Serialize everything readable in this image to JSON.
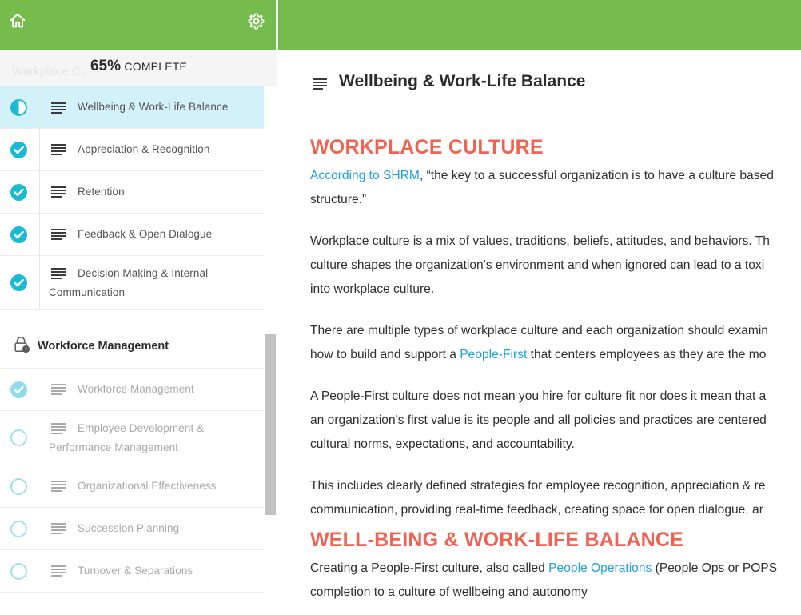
{
  "sidebar": {
    "progress_percent": "65%",
    "progress_label": "COMPLETE",
    "ghost_section_title": "Workplace Cu",
    "lessons_a": [
      {
        "label": "Wellbeing & Work-Life Balance",
        "status": "in-progress",
        "active": true
      },
      {
        "label": "Appreciation & Recognition",
        "status": "complete"
      },
      {
        "label": "Retention",
        "status": "complete"
      },
      {
        "label": "Feedback & Open Dialogue",
        "status": "complete"
      },
      {
        "label": "Decision Making & Internal Communication",
        "status": "complete"
      }
    ],
    "section": {
      "title": "Workforce Management",
      "icon": "lock-clock-icon"
    },
    "lessons_b": [
      {
        "label": "Workforce Management",
        "status": "complete-locked"
      },
      {
        "label": "Employee Development & Performance Management",
        "status": "not-started"
      },
      {
        "label": "Organizational Effectiveness",
        "status": "not-started"
      },
      {
        "label": "Succession Planning",
        "status": "not-started"
      },
      {
        "label": "Turnover & Separations",
        "status": "not-started"
      }
    ]
  },
  "main": {
    "page_title": "Wellbeing & Work-Life Balance",
    "heading_1": "WORKPLACE CULTURE",
    "p1_link": "According to SHRM",
    "p1_line1_rest": ", “the key to a successful organization is to have a culture based",
    "p1_line2": "structure.”",
    "p2_line1": "Workplace culture is a mix of values, traditions, beliefs, attitudes, and behaviors. Th",
    "p2_line2": "culture shapes the organization's environment and when ignored can lead to a toxi",
    "p2_line3": "into workplace culture.",
    "p3_line1": "There are multiple types of workplace culture and each organization should examin",
    "p3_line2_start": "how to build and support a ",
    "p3_link": "People-First",
    "p3_line2_end": " that centers employees as they are the mo",
    "p4_line1": "A People-First culture does not mean you hire for culture fit nor does it mean that a",
    "p4_line2": "an organization's first value is its people and all policies and practices are centered",
    "p4_line3": "cultural norms, expectations, and accountability.",
    "p5_line1": "This includes clearly defined strategies for employee recognition, appreciation & re",
    "p5_line2": "communication, providing real-time feedback,  creating space for open dialogue, ar",
    "heading_2": "WELL-BEING & WORK-LIFE BALANCE",
    "p6_line1_start": "Creating a People-First culture, also called ",
    "p6_link": "People Operations",
    "p6_line1_end": " (People Ops or POPS",
    "p6_line2": "completion to a culture of wellbeing and autonomy"
  },
  "colors": {
    "brand_green": "#74bc4b",
    "accent_teal": "#1cb9d4",
    "heading_red": "#ee6352",
    "link_blue": "#1da1d6"
  }
}
